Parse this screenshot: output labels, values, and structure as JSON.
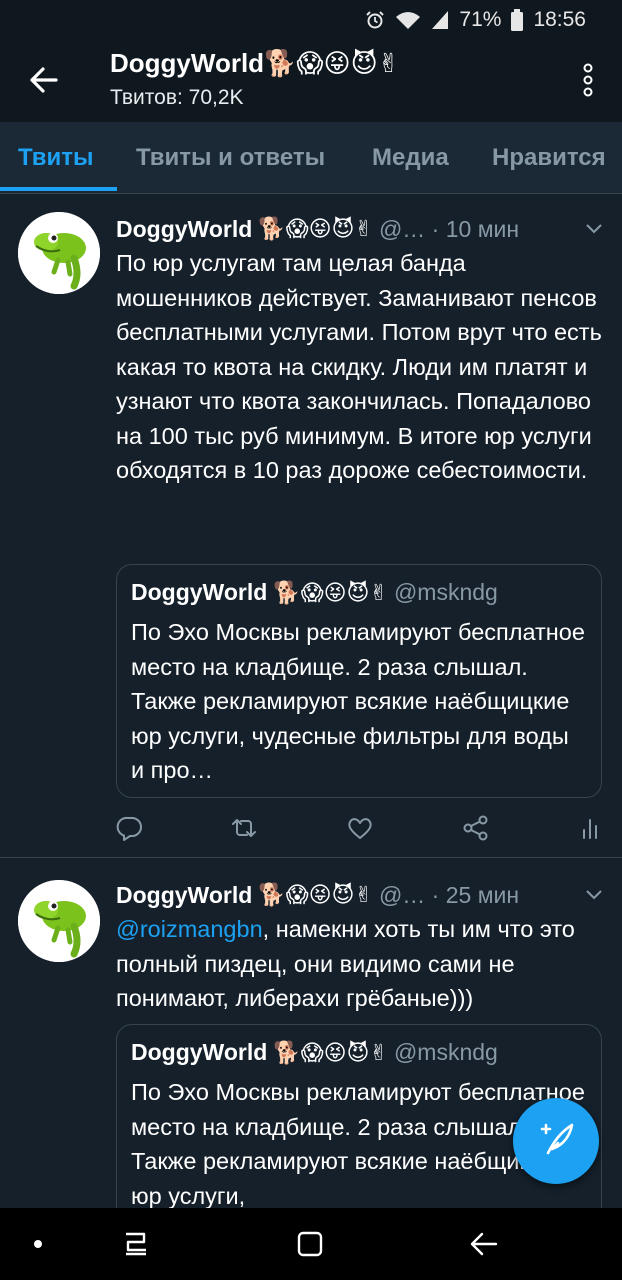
{
  "status_bar": {
    "battery": "71%",
    "time": "18:56",
    "icons": [
      "alarm-icon",
      "wifi-icon",
      "signal-icon",
      "battery-icon"
    ]
  },
  "header": {
    "title": "DoggyWorld🐕😱😝😈✌",
    "subtitle": "Твитов: 70,2K",
    "icons": [
      "back-arrow-icon",
      "more-vertical-icon"
    ]
  },
  "tabs": [
    {
      "label": "Твиты",
      "active": true
    },
    {
      "label": "Твиты и ответы",
      "active": false
    },
    {
      "label": "Медиа",
      "active": false
    },
    {
      "label": "Нравится",
      "active": false
    }
  ],
  "tweets": [
    {
      "name": "DoggyWorld",
      "emojis": "🐕😱😝😈✌",
      "meta": "@… · 10 мин",
      "text": "По юр услугам там целая банда мошенников действует. Заманивают пенсов бесплатными услугами. Потом врут что есть какая то квота на скидку. Люди им платят и узнают что квота закончилась. Попадалово на 100 тыс руб минимум. В итоге юр услуги обходятся в 10 раз дороже себестоимости.",
      "quote": {
        "name": "DoggyWorld",
        "emojis": "🐕😱😝😈✌",
        "handle": "@mskndg",
        "text": "По Эхо Москвы рекламируют бесплатное место на кладбище. 2 раза слышал. Также рекламируют всякие наёбщицкие юр услуги, чудесные фильтры для воды и про…"
      },
      "actions": [
        "reply-icon",
        "retweet-icon",
        "like-icon",
        "share-icon",
        "analytics-icon"
      ]
    },
    {
      "name": "DoggyWorld",
      "emojis": "🐕😱😝😈✌",
      "meta": "@… · 25 мин",
      "mention": "@roizmangbn",
      "text": ", намекни хоть ты им что это полный пиздец, они видимо сами не понимают, либерахи грёбаные)))",
      "quote": {
        "name": "DoggyWorld",
        "emojis": "🐕😱😝😈✌",
        "handle": "@mskndg",
        "text": "По Эхо Москвы рекламируют бесплатное место на кладбище. 2 раза слышал. Также рекламируют всякие наёбщицкие юр услуги,"
      }
    }
  ],
  "fab": {
    "icon": "compose-tweet-icon"
  },
  "nav_bar": {
    "icons": [
      "dot-icon",
      "recents-icon",
      "home-icon",
      "back-icon"
    ]
  },
  "colors": {
    "background": "#15202b",
    "accent": "#1da1f2",
    "secondary_text": "#8899a6",
    "divider": "#38444d"
  }
}
